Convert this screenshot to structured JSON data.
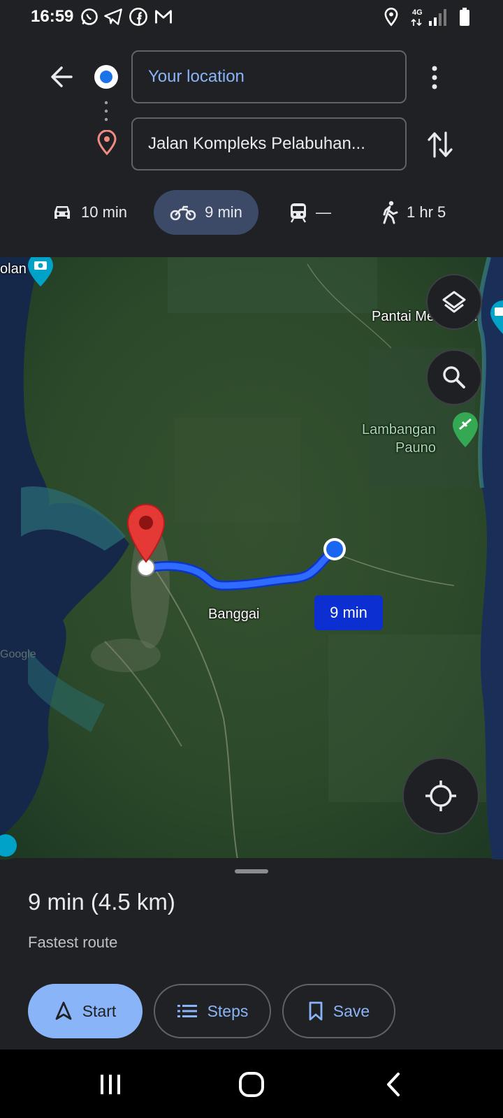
{
  "status_bar": {
    "time": "16:59",
    "network": "4G",
    "icons": [
      "whatsapp-icon",
      "telegram-icon",
      "facebook-icon",
      "gmail-icon",
      "location-icon",
      "signal-icon",
      "battery-icon"
    ]
  },
  "directions": {
    "origin": "Your location",
    "destination": "Jalan Kompleks Pelabuhan...",
    "modes": [
      {
        "name": "car",
        "label": "10 min",
        "icon": "car-icon"
      },
      {
        "name": "motorcycle",
        "label": "9 min",
        "icon": "motorcycle-icon",
        "selected": true
      },
      {
        "name": "transit",
        "label": "—",
        "icon": "train-icon"
      },
      {
        "name": "walk",
        "label": "1 hr 5",
        "icon": "walking-icon"
      }
    ]
  },
  "map": {
    "labels": {
      "top_left": "olan",
      "pantai": "Pantai Mendatan",
      "lambangan_1": "Lambangan",
      "lambangan_2": "Pauno",
      "town": "Banggai",
      "google_watermark": "Google"
    },
    "route_badge": "9 min",
    "route_color": "#1a53ff"
  },
  "sheet": {
    "summary": "9 min (4.5 km)",
    "note": "Fastest route",
    "start_label": "Start",
    "steps_label": "Steps",
    "save_label": "Save"
  },
  "colors": {
    "accent": "#8ab4f8",
    "background": "#202124",
    "destination_pin": "#d93025"
  }
}
